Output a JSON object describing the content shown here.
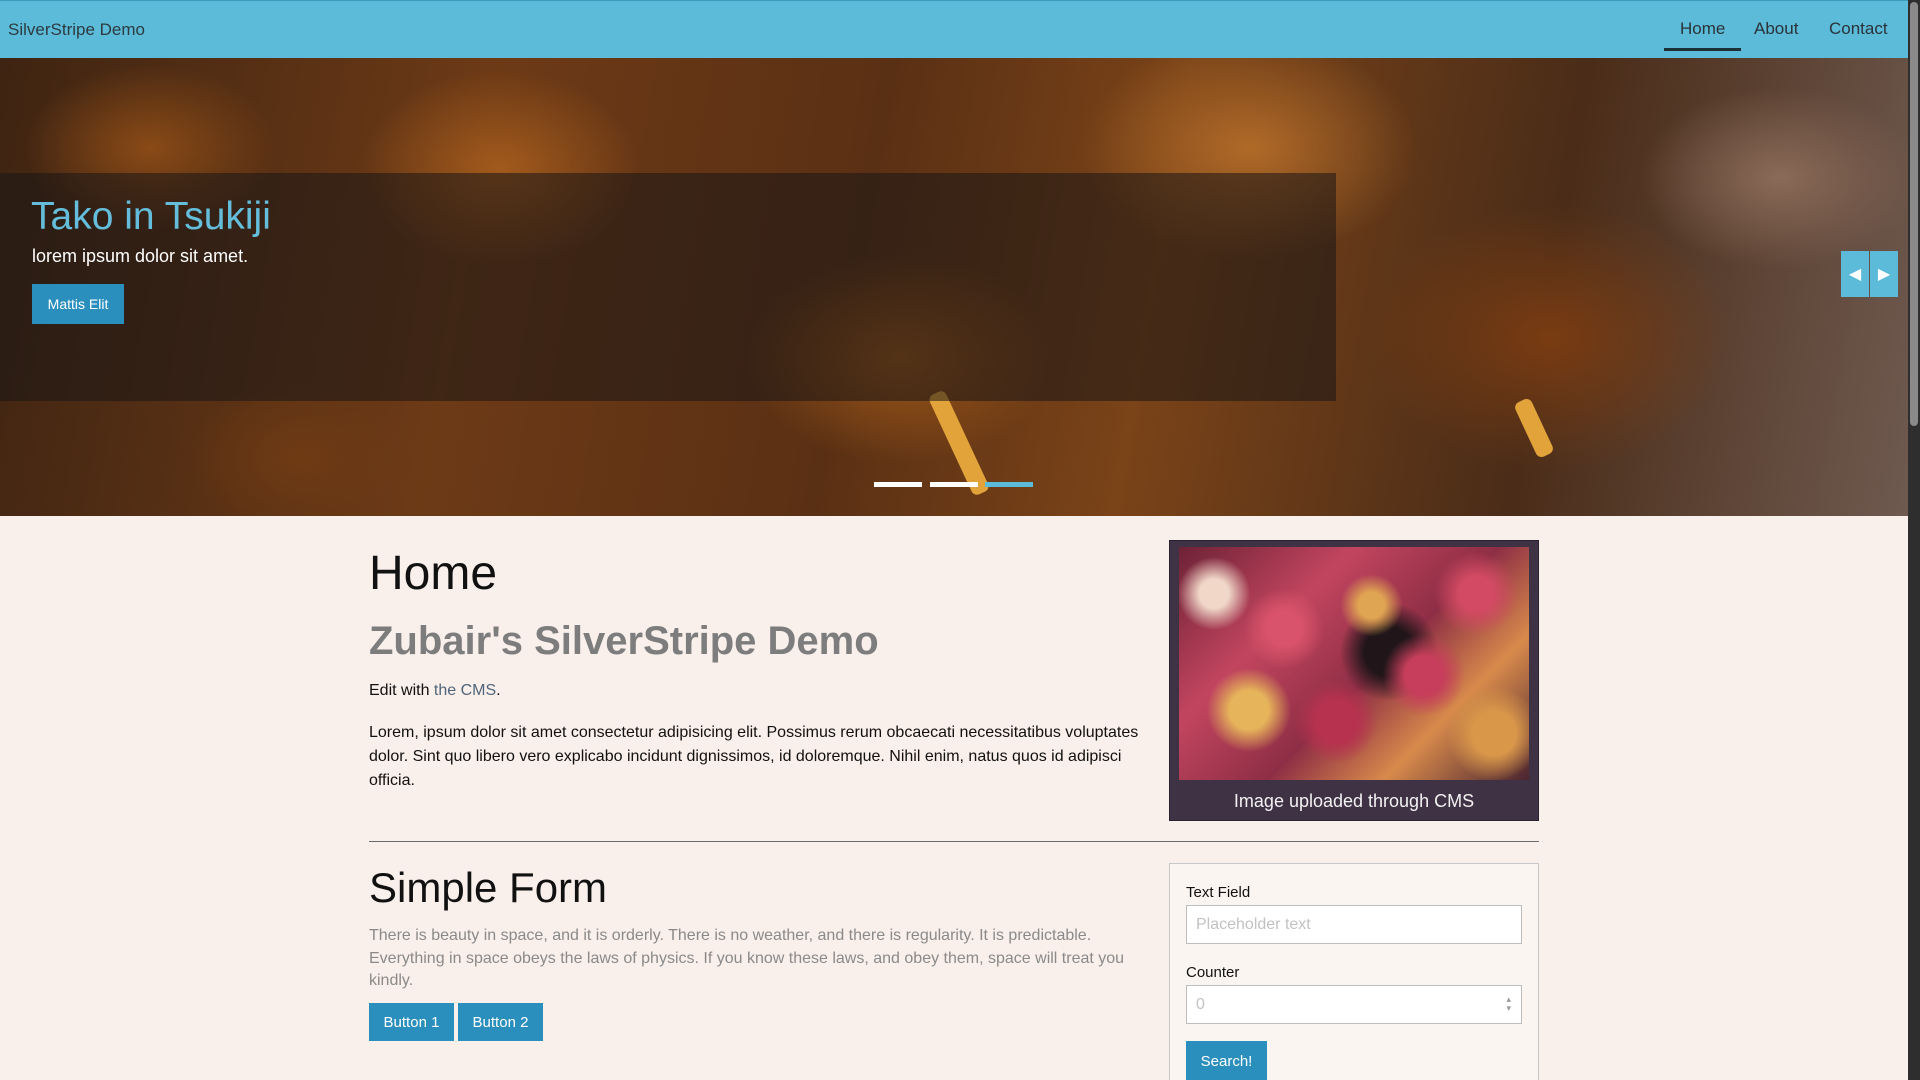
{
  "navbar": {
    "brand": "SilverStripe Demo",
    "items": [
      {
        "label": "Home",
        "active": true
      },
      {
        "label": "About",
        "active": false
      },
      {
        "label": "Contact",
        "active": false
      }
    ]
  },
  "carousel": {
    "title": "Tako in Tsukiji",
    "text": "lorem ipsum dolor sit amet.",
    "button_label": "Mattis Elit",
    "prev_icon": "◀",
    "next_icon": "▶",
    "indicator_count": 3,
    "active_index": 2
  },
  "main": {
    "heading": "Home",
    "subheading": "Zubair's SilverStripe Demo",
    "edit_prefix": "Edit with ",
    "edit_link": "the CMS",
    "edit_suffix": ".",
    "body": "Lorem, ipsum dolor sit amet consectetur adipisicing elit. Possimus rerum obcaecati necessitatibus voluptates dolor. Sint quo libero vero explicabo incidunt dignissimos, id doloremque. Nihil enim, natus quos id adipisci officia."
  },
  "image_card": {
    "caption": "Image uploaded through CMS"
  },
  "form_section": {
    "heading": "Simple Form",
    "quote": "There is beauty in space, and it is orderly. There is no weather, and there is regularity. It is predictable. Everything in space obeys the laws of physics. If you know these laws, and obey them, space will treat you kindly.",
    "button1": "Button 1",
    "button2": "Button 2"
  },
  "form": {
    "text_label": "Text Field",
    "text_placeholder": "Placeholder text",
    "counter_label": "Counter",
    "counter_placeholder": "0",
    "submit_label": "Search!"
  },
  "colors": {
    "accent": "#5bbbd9",
    "button": "#2b8fbd",
    "page_bg": "#f9efeb"
  }
}
